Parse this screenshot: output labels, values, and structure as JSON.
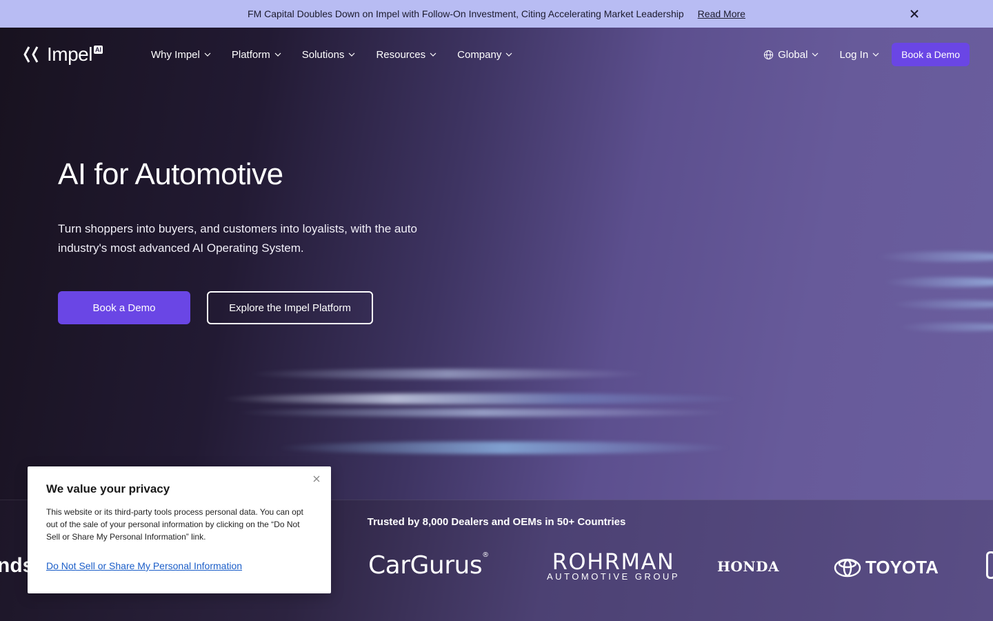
{
  "announcement": {
    "message": "FM Capital Doubles Down on Impel with Follow-On Investment, Citing Accelerating Market Leadership",
    "link_label": "Read More",
    "close_icon": "close-icon"
  },
  "nav": {
    "logo_text": "Impel",
    "logo_badge": "AI",
    "items": [
      {
        "label": "Why Impel"
      },
      {
        "label": "Platform"
      },
      {
        "label": "Solutions"
      },
      {
        "label": "Resources"
      },
      {
        "label": "Company"
      }
    ],
    "region_label": "Global",
    "login_label": "Log In",
    "demo_label": "Book a Demo"
  },
  "hero": {
    "title": "AI for Automotive",
    "subtitle": "Turn shoppers into buyers, and customers into loyalists, with the auto industry's most advanced AI Operating System.",
    "primary_cta": "Book a Demo",
    "secondary_cta": "Explore the Impel Platform"
  },
  "trusted": {
    "title": "Trusted by 8,000 Dealers and OEMs in 50+ Countries",
    "brands": {
      "partial": "nds",
      "cargurus": "CarGurus",
      "cargurus_mark": "®",
      "rohrman_main": "ROHRMAN",
      "rohrman_sub": "AUTOMOTIVE GROUP",
      "honda": "HONDA",
      "toyota": "TOYOTA"
    }
  },
  "privacy": {
    "title": "We value your privacy",
    "body": "This website or its third-party tools process personal data. You can opt out of the sale of your personal information by clicking on the “Do Not Sell or Share My Personal Information” link.",
    "link": "Do Not Sell or Share My Personal Information"
  },
  "colors": {
    "accent": "#6a46e5",
    "announcement_bg": "#b8bcf3",
    "link_blue": "#1a5dc8"
  }
}
